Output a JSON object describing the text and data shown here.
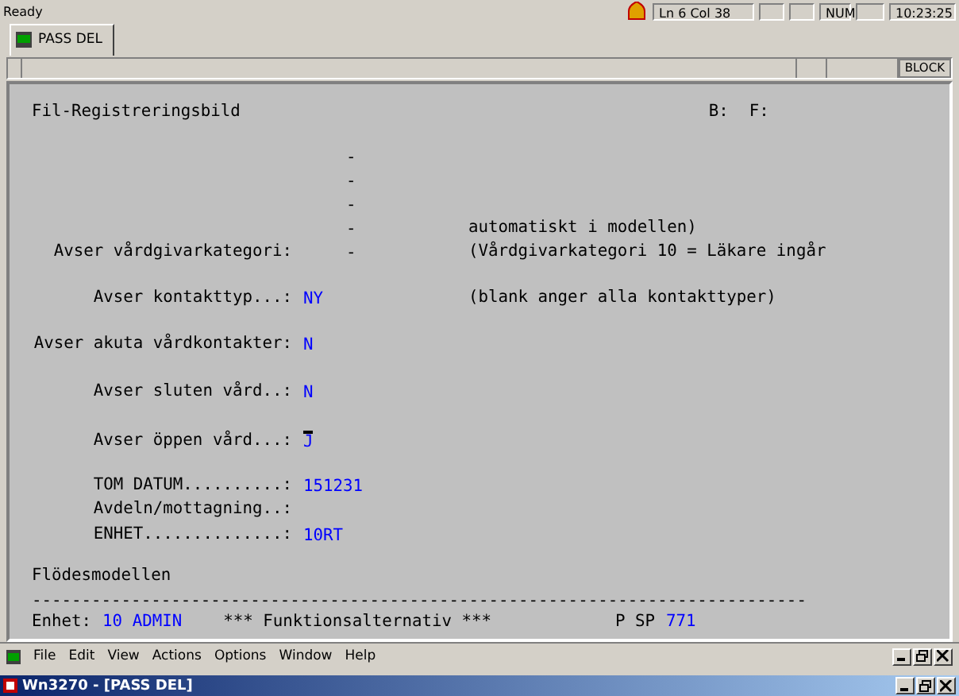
{
  "status_bar": {
    "message": "Ready",
    "position": "Ln 6 Col 38",
    "num": "NUM",
    "time": "10:23:25"
  },
  "tabs": [
    {
      "label": "PASS DEL",
      "selected": true
    }
  ],
  "block_bar": {
    "mode": "BLOCK"
  },
  "terminal": {
    "screen_title": "Fil-Registreringsbild",
    "flags": [
      "B:",
      "F:"
    ],
    "fields": [
      {
        "kind": "list",
        "value": "-",
        "cursor": false
      },
      {
        "kind": "list",
        "value": "-",
        "cursor": false
      },
      {
        "kind": "list",
        "value": "-",
        "cursor": false
      },
      {
        "kind": "list",
        "value": "-",
        "note": "automatiskt i modellen)",
        "cursor": false
      },
      {
        "kind": "list",
        "label": "Avser vårdgivarkategori:",
        "value": "-",
        "note": "(Vårdgivarkategori 10 = Läkare ingår",
        "cursor": false
      },
      {
        "kind": "field",
        "label": "Avser kontakttyp...:",
        "value": "NY",
        "note": "(blank anger alla kontakttyper)",
        "cursor": false
      },
      {
        "kind": "field",
        "label": "Avser akuta vårdkontakter:",
        "value": "N",
        "cursor": false
      },
      {
        "kind": "field",
        "label": "Avser sluten vård..:",
        "value": "N",
        "cursor": false
      },
      {
        "kind": "field",
        "label": "Avser öppen vård...:",
        "value": "J",
        "cursor": true
      },
      {
        "kind": "field",
        "label": "TOM DATUM..........:",
        "value": "151231",
        "cursor": false
      },
      {
        "kind": "field",
        "label": "Avdeln/mottagning..:",
        "cursor": false
      },
      {
        "kind": "field",
        "label": "ENHET..............:",
        "value": "10RT",
        "cursor": false
      }
    ],
    "section": "Flödesmodellen",
    "rule": "------------------------------------------------------------------------------",
    "header": {
      "unit_label": "Enhet:",
      "unit": "10 ADMIN",
      "title": "*** Funktionsalternativ ***",
      "page_label": "P SP",
      "page": "771"
    }
  },
  "menu": [
    "File",
    "Edit",
    "View",
    "Actions",
    "Options",
    "Window",
    "Help"
  ],
  "window": {
    "title": "Wn3270 - [PASS DEL]"
  }
}
